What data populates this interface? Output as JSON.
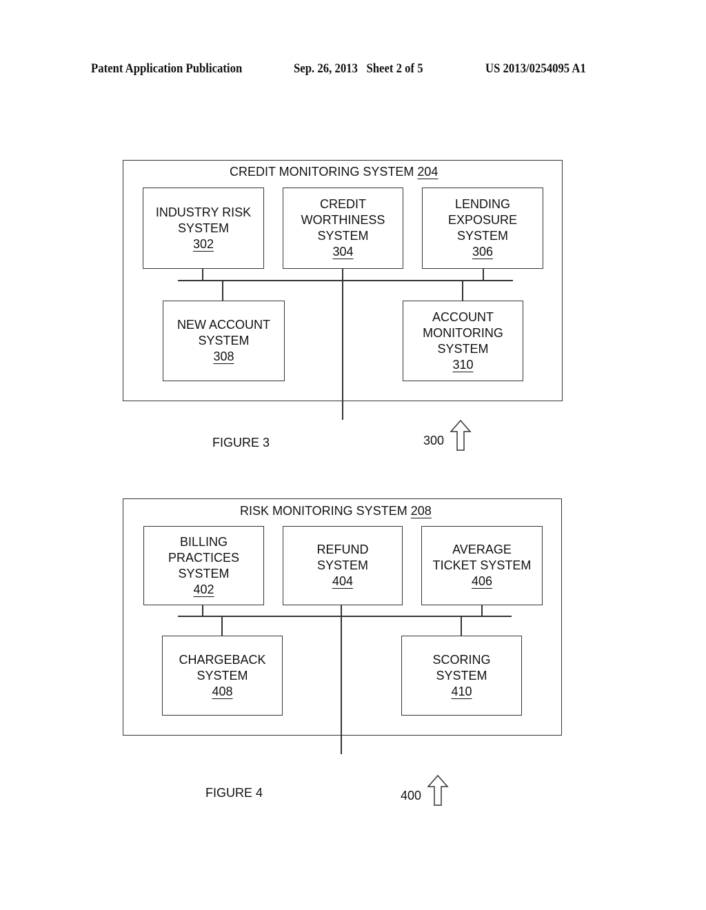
{
  "header": {
    "publication": "Patent Application Publication",
    "date_sheet": "Sep. 26, 2013   Sheet 2 of 5",
    "number": "US 2013/0254095 A1"
  },
  "figure3": {
    "title": "CREDIT MONITORING SYSTEM",
    "title_ref": "204",
    "boxes": [
      {
        "lines": [
          "INDUSTRY RISK",
          "SYSTEM"
        ],
        "ref": "302"
      },
      {
        "lines": [
          "CREDIT",
          "WORTHINESS",
          "SYSTEM"
        ],
        "ref": "304"
      },
      {
        "lines": [
          "LENDING",
          "EXPOSURE",
          "SYSTEM"
        ],
        "ref": "306"
      },
      {
        "lines": [
          "NEW ACCOUNT",
          "SYSTEM"
        ],
        "ref": "308"
      },
      {
        "lines": [
          "ACCOUNT",
          "MONITORING",
          "SYSTEM"
        ],
        "ref": "310"
      }
    ],
    "caption": "FIGURE 3",
    "pointer_ref": "300"
  },
  "figure4": {
    "title": "RISK MONITORING SYSTEM",
    "title_ref": "208",
    "boxes": [
      {
        "lines": [
          "BILLING",
          "PRACTICES",
          "SYSTEM"
        ],
        "ref": "402"
      },
      {
        "lines": [
          "REFUND",
          "SYSTEM"
        ],
        "ref": "404"
      },
      {
        "lines": [
          "AVERAGE",
          "TICKET SYSTEM"
        ],
        "ref": "406"
      },
      {
        "lines": [
          "CHARGEBACK",
          "SYSTEM"
        ],
        "ref": "408"
      },
      {
        "lines": [
          "SCORING",
          "SYSTEM"
        ],
        "ref": "410"
      }
    ],
    "caption": "FIGURE 4",
    "pointer_ref": "400"
  }
}
